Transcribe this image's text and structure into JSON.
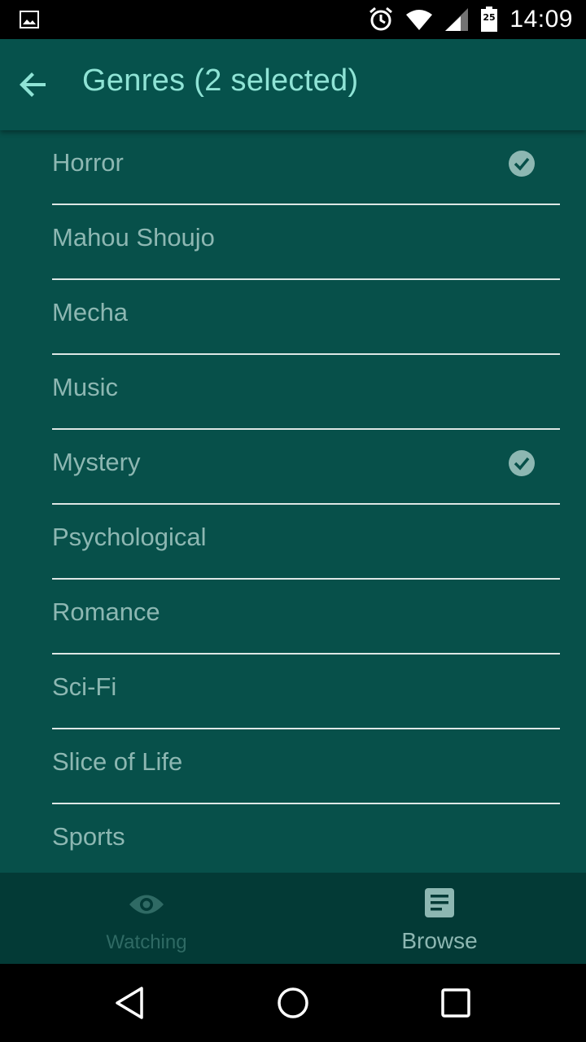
{
  "status_bar": {
    "time": "14:09",
    "battery_level": "25",
    "icons": [
      "gallery-icon",
      "alarm-icon",
      "wifi-icon",
      "signal-icon",
      "battery-icon"
    ]
  },
  "toolbar": {
    "title": "Genres (2 selected)",
    "back_icon": "arrow-back-icon"
  },
  "genres": [
    {
      "label": "Horror",
      "selected": true
    },
    {
      "label": "Mahou Shoujo",
      "selected": false
    },
    {
      "label": "Mecha",
      "selected": false
    },
    {
      "label": "Music",
      "selected": false
    },
    {
      "label": "Mystery",
      "selected": true
    },
    {
      "label": "Psychological",
      "selected": false
    },
    {
      "label": "Romance",
      "selected": false
    },
    {
      "label": "Sci-Fi",
      "selected": false
    },
    {
      "label": "Slice of Life",
      "selected": false
    },
    {
      "label": "Sports",
      "selected": false
    }
  ],
  "bottom_nav": {
    "items": [
      {
        "label": "Watching",
        "icon": "eye-icon",
        "active": false
      },
      {
        "label": "Browse",
        "icon": "document-icon",
        "active": true
      }
    ]
  },
  "system_nav": {
    "icons": [
      "back-triangle-icon",
      "home-circle-icon",
      "recents-square-icon"
    ]
  },
  "colors": {
    "toolbar_bg": "#06524C",
    "list_bg": "#07504A",
    "title_text": "#8FE3D5",
    "item_text": "#8DB7B2",
    "divider": "#DDE7E5",
    "bottom_nav_bg": "#033A36",
    "inactive_nav": "#2F6A64"
  }
}
